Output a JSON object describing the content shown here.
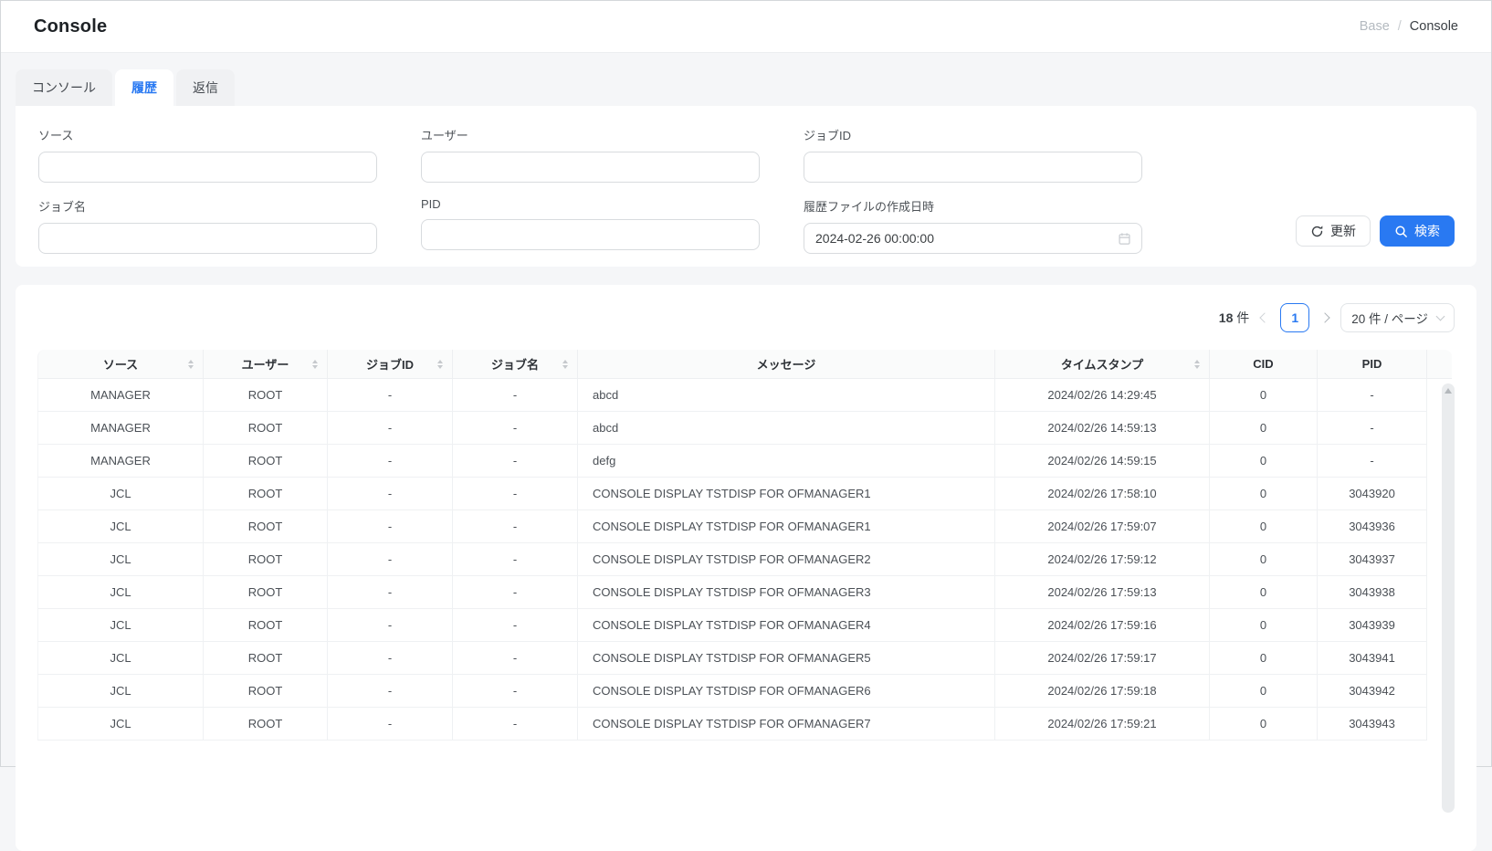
{
  "header": {
    "title": "Console",
    "breadcrumb": {
      "prev": "Base",
      "separator": "/",
      "current": "Console"
    }
  },
  "tabs": [
    {
      "label": "コンソール",
      "active": false
    },
    {
      "label": "履歴",
      "active": true
    },
    {
      "label": "返信",
      "active": false
    }
  ],
  "filters": {
    "source_label": "ソース",
    "user_label": "ユーザー",
    "job_id_label": "ジョブID",
    "job_name_label": "ジョブ名",
    "pid_label": "PID",
    "history_date_label": "履歴ファイルの作成日時",
    "history_date_value": "2024-02-26 00:00:00",
    "refresh_button": "更新",
    "search_button": "検索"
  },
  "pagination": {
    "total_count": "18",
    "total_unit": "件",
    "current_page": "1",
    "page_size_label": "20 件 / ページ"
  },
  "table": {
    "columns": [
      {
        "label": "ソース",
        "sortable": true,
        "align": "center"
      },
      {
        "label": "ユーザー",
        "sortable": true,
        "align": "center"
      },
      {
        "label": "ジョブID",
        "sortable": true,
        "align": "center"
      },
      {
        "label": "ジョブ名",
        "sortable": true,
        "align": "center"
      },
      {
        "label": "メッセージ",
        "sortable": false,
        "align": "left"
      },
      {
        "label": "タイムスタンプ",
        "sortable": true,
        "align": "center"
      },
      {
        "label": "CID",
        "sortable": false,
        "align": "center"
      },
      {
        "label": "PID",
        "sortable": false,
        "align": "center"
      }
    ],
    "rows": [
      [
        "MANAGER",
        "ROOT",
        "-",
        "-",
        "abcd",
        "2024/02/26 14:29:45",
        "0",
        "-"
      ],
      [
        "MANAGER",
        "ROOT",
        "-",
        "-",
        "abcd",
        "2024/02/26 14:59:13",
        "0",
        "-"
      ],
      [
        "MANAGER",
        "ROOT",
        "-",
        "-",
        "defg",
        "2024/02/26 14:59:15",
        "0",
        "-"
      ],
      [
        "JCL",
        "ROOT",
        "-",
        "-",
        "CONSOLE DISPLAY TSTDISP FOR OFMANAGER1",
        "2024/02/26 17:58:10",
        "0",
        "3043920"
      ],
      [
        "JCL",
        "ROOT",
        "-",
        "-",
        "CONSOLE DISPLAY TSTDISP FOR OFMANAGER1",
        "2024/02/26 17:59:07",
        "0",
        "3043936"
      ],
      [
        "JCL",
        "ROOT",
        "-",
        "-",
        "CONSOLE DISPLAY TSTDISP FOR OFMANAGER2",
        "2024/02/26 17:59:12",
        "0",
        "3043937"
      ],
      [
        "JCL",
        "ROOT",
        "-",
        "-",
        "CONSOLE DISPLAY TSTDISP FOR OFMANAGER3",
        "2024/02/26 17:59:13",
        "0",
        "3043938"
      ],
      [
        "JCL",
        "ROOT",
        "-",
        "-",
        "CONSOLE DISPLAY TSTDISP FOR OFMANAGER4",
        "2024/02/26 17:59:16",
        "0",
        "3043939"
      ],
      [
        "JCL",
        "ROOT",
        "-",
        "-",
        "CONSOLE DISPLAY TSTDISP FOR OFMANAGER5",
        "2024/02/26 17:59:17",
        "0",
        "3043941"
      ],
      [
        "JCL",
        "ROOT",
        "-",
        "-",
        "CONSOLE DISPLAY TSTDISP FOR OFMANAGER6",
        "2024/02/26 17:59:18",
        "0",
        "3043942"
      ],
      [
        "JCL",
        "ROOT",
        "-",
        "-",
        "CONSOLE DISPLAY TSTDISP FOR OFMANAGER7",
        "2024/02/26 17:59:21",
        "0",
        "3043943"
      ]
    ]
  },
  "colors": {
    "primary": "#2979f2",
    "header_bg": "#fafbfb",
    "page_bg": "#f5f6f8"
  }
}
